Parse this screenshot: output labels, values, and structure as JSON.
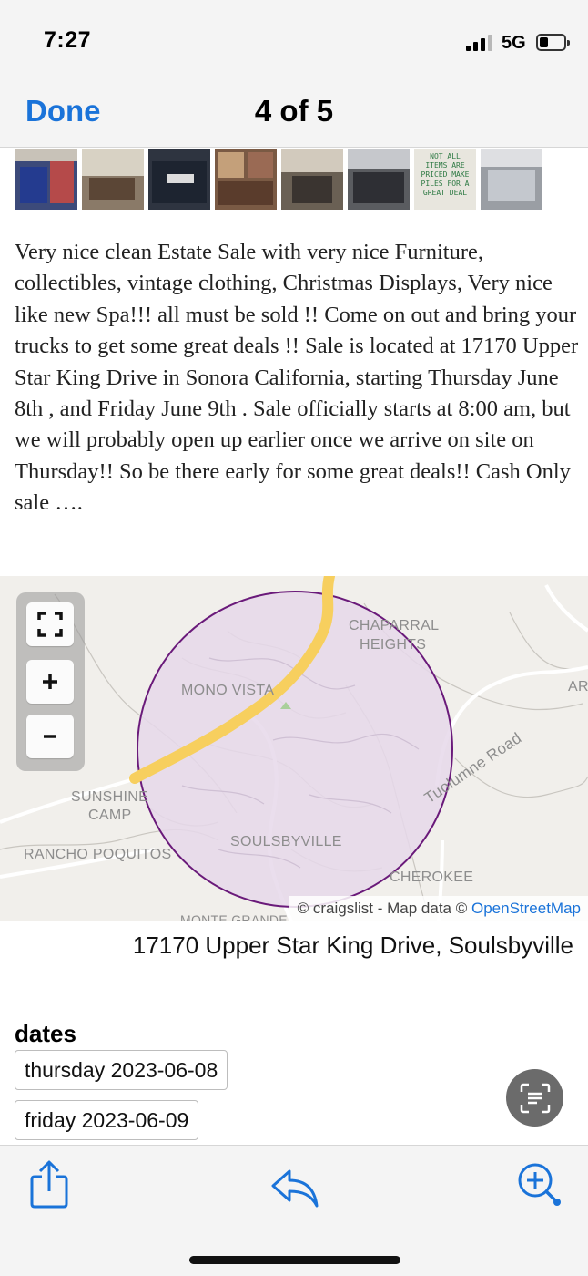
{
  "status_bar": {
    "time": "7:27",
    "network": "5G",
    "signal_bars_filled": 3,
    "signal_bars_total": 4,
    "battery_level": "low"
  },
  "nav": {
    "done_label": "Done",
    "title": "4 of 5"
  },
  "thumbnails": [
    {
      "name": "photo-1",
      "color": "#3c4a7a"
    },
    {
      "name": "photo-2",
      "color": "#8a7a68"
    },
    {
      "name": "photo-3",
      "color": "#2e3440"
    },
    {
      "name": "photo-4",
      "color": "#7a5a44"
    },
    {
      "name": "photo-5",
      "color": "#6a6054"
    },
    {
      "name": "photo-6",
      "color": "#5a5c60"
    },
    {
      "name": "photo-7",
      "color": "#e8e6de",
      "text": "NOT ALL ITEMS ARE PRICED MAKE PILES FOR A GREAT DEAL"
    },
    {
      "name": "photo-8",
      "color": "#9a9ea4"
    }
  ],
  "description": "Very nice clean Estate Sale with very nice Furniture, collectibles, vintage clothing, Christmas Displays, Very nice like new Spa!!! all must be sold !! Come on out and bring your trucks to get some great deals !! Sale is located at 17170 Upper Star King Drive in Sonora California, starting Thursday June 8th , and Friday June 9th . Sale officially starts at 8:00 am, but we will probably open up earlier once we arrive on site on Thursday!! So be there early for some great deals!! Cash Only sale ….",
  "map": {
    "labels": {
      "chaparral_1": "CHAPARRAL",
      "chaparral_2": "HEIGHTS",
      "mono_vista": "MONO VISTA",
      "sunshine_1": "SUNSHINE",
      "sunshine_2": "CAMP",
      "rancho": "RANCHO POQUITOS",
      "soulsbyville": "SOULSBYVILLE",
      "cherokee": "CHEROKEE",
      "tuolumne_road": "Tuolumne Road",
      "ar": "AR",
      "monte": "MONTE GRANDE"
    },
    "attribution": "© craigslist - Map data © ",
    "attribution_link": "OpenStreetMap",
    "circle_fill": "#e6d8ea",
    "circle_stroke": "#6a1a7a",
    "highway_color": "#f7cf5e"
  },
  "address": "17170 Upper Star King Drive, Soulsbyville",
  "dates": {
    "heading": "dates",
    "items": [
      "thursday 2023-06-08",
      "friday 2023-06-09"
    ]
  },
  "colors": {
    "accent": "#1a73d9"
  }
}
